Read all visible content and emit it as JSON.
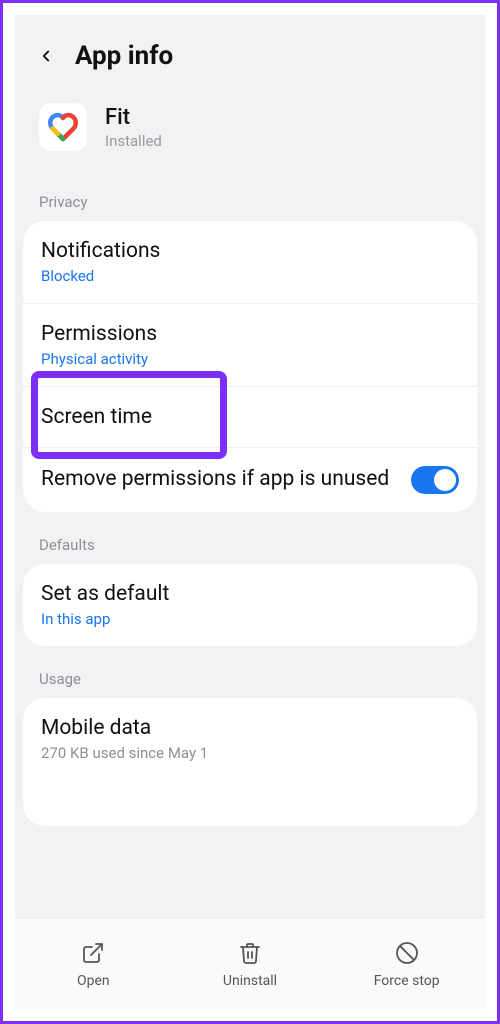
{
  "header": {
    "title": "App info"
  },
  "app": {
    "name": "Fit",
    "status": "Installed"
  },
  "sections": {
    "privacy": {
      "label": "Privacy",
      "notifications": {
        "title": "Notifications",
        "sub": "Blocked"
      },
      "permissions": {
        "title": "Permissions",
        "sub": "Physical activity"
      },
      "screen_time": {
        "title": "Screen time"
      },
      "remove_perms": {
        "title": "Remove permissions if app is unused"
      }
    },
    "defaults": {
      "label": "Defaults",
      "set_default": {
        "title": "Set as default",
        "sub": "In this app"
      }
    },
    "usage": {
      "label": "Usage",
      "mobile_data": {
        "title": "Mobile data",
        "sub": "270 KB used since May 1"
      }
    }
  },
  "bottom": {
    "open": "Open",
    "uninstall": "Uninstall",
    "force_stop": "Force stop"
  }
}
